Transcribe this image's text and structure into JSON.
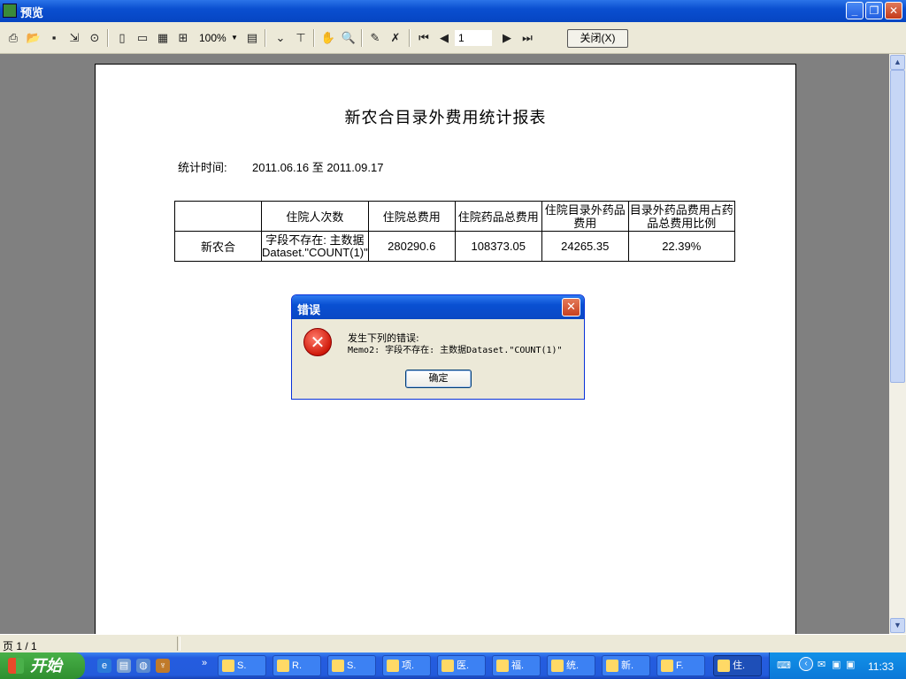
{
  "window": {
    "title": "预览"
  },
  "toolbar": {
    "zoom": "100%",
    "page_value": "1",
    "close_label": "关闭(X)"
  },
  "report": {
    "title": "新农合目录外费用统计报表",
    "stat_label": "统计时间:",
    "stat_range": "2011.06.16 至 2011.09.17",
    "headers": [
      "",
      "住院人次数",
      "住院总费用",
      "住院药品总费用",
      "住院目录外药品费用",
      "目录外药品费用占药品总费用比例"
    ],
    "row": {
      "name": "新农合",
      "count_error": "字段不存在: 主数据Dataset.\"COUNT(1)\"",
      "total_cost": "280290.6",
      "drug_cost": "108373.05",
      "outside_drug_cost": "24265.35",
      "ratio": "22.39%"
    }
  },
  "status": {
    "page": "页 1 / 1"
  },
  "dialog": {
    "title": "错误",
    "message_line1": "发生下列的错误:",
    "message_line2": "Memo2: 字段不存在: 主数据Dataset.\"COUNT(1)\"",
    "ok_label": "确定"
  },
  "taskbar": {
    "start_label": "开始",
    "tasks": [
      "S.",
      "R.",
      "S.",
      "项.",
      "医.",
      "福.",
      "统.",
      "新.",
      "F.",
      "住."
    ],
    "clock": "11:33"
  }
}
